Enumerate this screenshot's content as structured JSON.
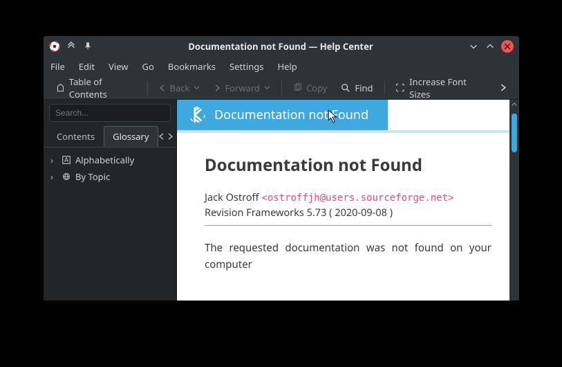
{
  "titlebar": {
    "title": "Documentation not Found — Help Center"
  },
  "menubar": {
    "file": "File",
    "edit": "Edit",
    "view": "View",
    "go": "Go",
    "bookmarks": "Bookmarks",
    "settings": "Settings",
    "help": "Help"
  },
  "toolbar": {
    "toc": "Table of Contents",
    "back": "Back",
    "forward": "Forward",
    "copy": "Copy",
    "find": "Find",
    "increase_font": "Increase Font Sizes"
  },
  "sidebar": {
    "search_placeholder": "Search...",
    "tabs": {
      "contents": "Contents",
      "glossary": "Glossary"
    },
    "tree": [
      {
        "label": "Alphabetically"
      },
      {
        "label": "By Topic"
      }
    ]
  },
  "document": {
    "header": "Documentation not Found",
    "title": "Documentation not Found",
    "author": "Jack Ostroff",
    "email": "<ostroffjh@users.sourceforge.net>",
    "revision": "Revision Frameworks 5.73 ( 2020-09-08 )",
    "body": "The requested documentation was not found on your computer"
  }
}
